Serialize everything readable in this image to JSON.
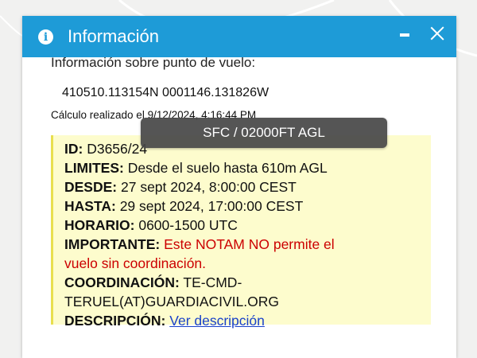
{
  "window": {
    "title": "Información",
    "info_icon": "info-icon",
    "minimize_icon": "minimize-icon",
    "close_icon": "close-icon"
  },
  "content": {
    "heading": "Información sobre punto de vuelo:",
    "coordinates": "410510.113154N 0001146.131826W",
    "calc_label": "Cálculo realizado el 9/12/2024, 4:16:44 PM"
  },
  "tooltip": "SFC / 02000FT AGL",
  "notam": {
    "id_label": "ID:",
    "id_value": "D3656/24",
    "limites_label": "LIMITES:",
    "limites_value": "Desde el suelo hasta 610m AGL",
    "desde_label": "DESDE:",
    "desde_value": "27 sept 2024, 8:00:00 CEST",
    "hasta_label": "HASTA:",
    "hasta_value": "29 sept 2024, 17:00:00 CEST",
    "horario_label": "HORARIO:",
    "horario_value": "0600-1500 UTC",
    "importante_label": "IMPORTANTE:",
    "importante_value_1": "Este NOTAM NO permite el",
    "importante_value_2": "vuelo sin coordinación.",
    "coordinacion_label": "COORDINACIÓN:",
    "coordinacion_value_1": "TE-CMD-",
    "coordinacion_value_2": "TERUEL(AT)GUARDIACIVIL.ORG",
    "descripcion_label": "DESCRIPCIÓN:",
    "descripcion_link": "Ver descripción"
  },
  "colors": {
    "titlebar": "#1e9bd7",
    "notam_background": "#fdfccd",
    "notam_border": "#e8df4e",
    "warning_text": "#cc0000",
    "link": "#1a42c9"
  }
}
